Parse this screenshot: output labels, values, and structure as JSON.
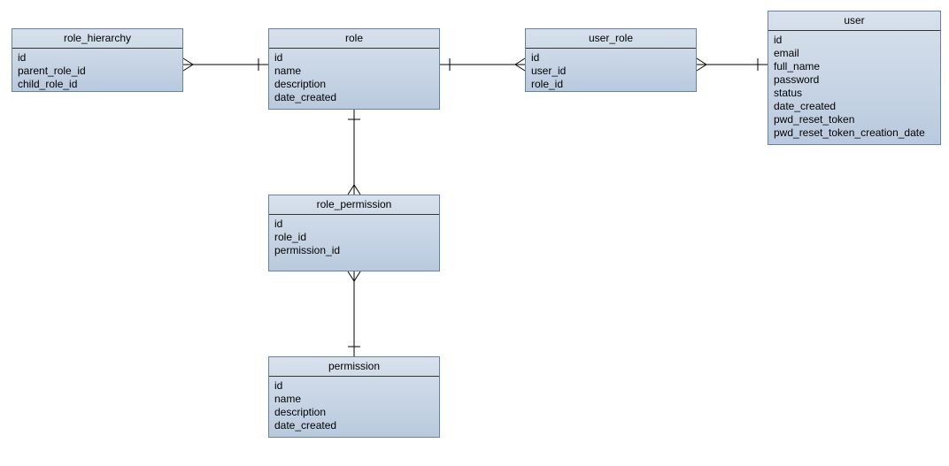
{
  "entities": {
    "role_hierarchy": {
      "title": "role_hierarchy",
      "attrs": [
        "id",
        "parent_role_id",
        "child_role_id"
      ]
    },
    "role": {
      "title": "role",
      "attrs": [
        "id",
        "name",
        "description",
        "date_created"
      ]
    },
    "user_role": {
      "title": "user_role",
      "attrs": [
        "id",
        "user_id",
        "role_id"
      ]
    },
    "user": {
      "title": "user",
      "attrs": [
        "id",
        "email",
        "full_name",
        "password",
        "status",
        "date_created",
        "pwd_reset_token",
        "pwd_reset_token_creation_date"
      ]
    },
    "role_permission": {
      "title": "role_permission",
      "attrs": [
        "id",
        "role_id",
        "permission_id"
      ]
    },
    "permission": {
      "title": "permission",
      "attrs": [
        "id",
        "name",
        "description",
        "date_created"
      ]
    }
  }
}
